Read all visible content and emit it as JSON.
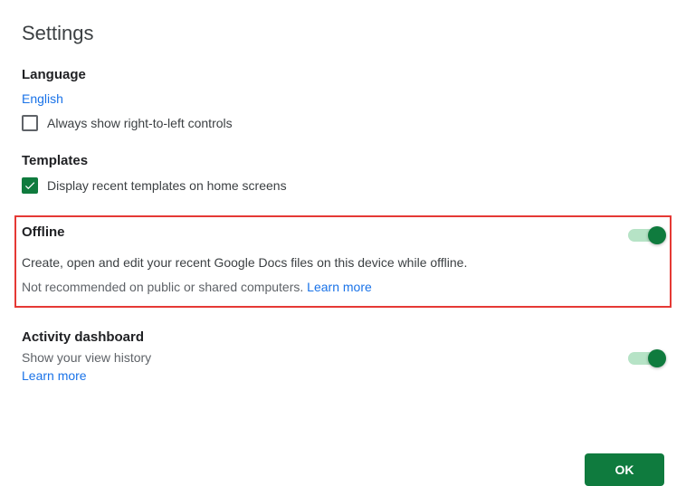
{
  "title": "Settings",
  "language": {
    "header": "Language",
    "current": "English",
    "rtl_label": "Always show right-to-left controls",
    "rtl_checked": false
  },
  "templates": {
    "header": "Templates",
    "recent_label": "Display recent templates on home screens",
    "recent_checked": true
  },
  "offline": {
    "header": "Offline",
    "desc1": "Create, open and edit your recent Google Docs files on this device while offline.",
    "desc2": "Not recommended on public or shared computers. ",
    "learn_more": "Learn more",
    "enabled": true
  },
  "activity": {
    "header": "Activity dashboard",
    "subtitle": "Show your view history",
    "learn_more": "Learn more",
    "enabled": true
  },
  "footer": {
    "ok_label": "OK"
  }
}
